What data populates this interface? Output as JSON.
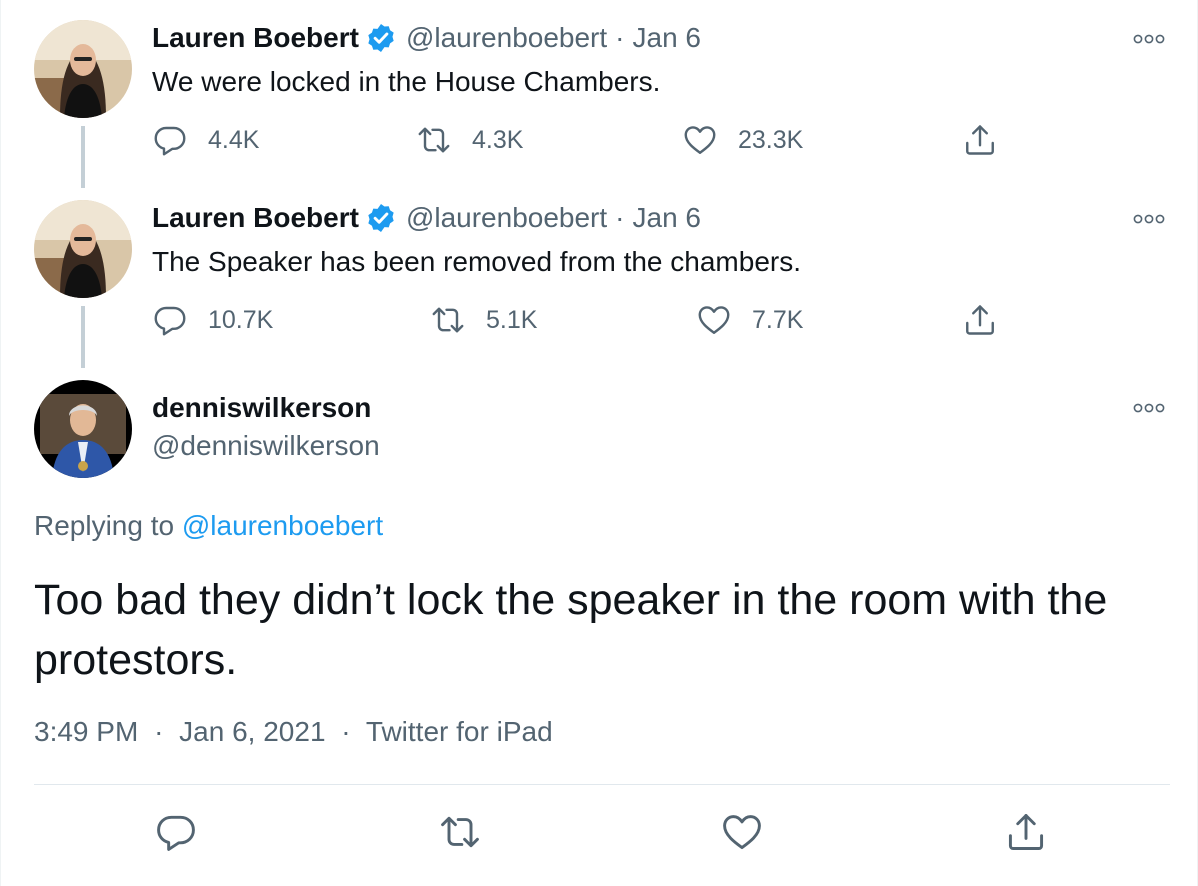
{
  "thread": [
    {
      "name": "Lauren Boebert",
      "handle": "@laurenboebert",
      "separator": "·",
      "date": "Jan 6",
      "text": "We were locked in the House Chambers.",
      "replies": "4.4K",
      "retweets": "4.3K",
      "likes": "23.3K"
    },
    {
      "name": "Lauren Boebert",
      "handle": "@laurenboebert",
      "separator": "·",
      "date": "Jan 6",
      "text": "The Speaker has been removed from the chambers.",
      "replies": "10.7K",
      "retweets": "5.1K",
      "likes": "7.7K"
    }
  ],
  "main_tweet": {
    "name": "denniswilkerson",
    "handle": "@denniswilkerson",
    "replying_prefix": "Replying to",
    "replying_to": "@laurenboebert",
    "text": "Too bad they didn’t lock the speaker in the room with the protestors.",
    "time": "3:49 PM",
    "date": "Jan 6, 2021",
    "source": "Twitter for iPad",
    "separator": "·"
  },
  "icons": {
    "reply": "reply-icon",
    "retweet": "retweet-icon",
    "like": "heart-icon",
    "share": "share-icon",
    "more": "more-options-icon",
    "verified": "verified-badge-icon"
  },
  "colors": {
    "link": "#1d9bf0",
    "muted": "#536471",
    "text": "#0f1419",
    "thread_line": "#c4cfd6",
    "verified": "#1d9bf0"
  }
}
